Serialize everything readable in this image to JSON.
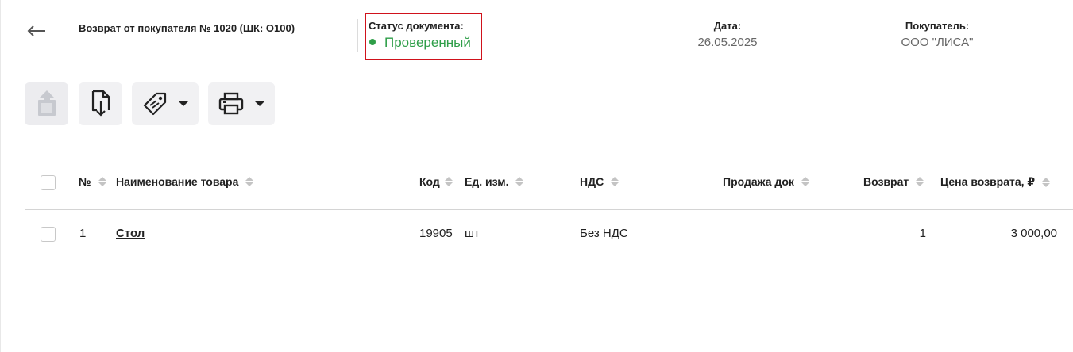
{
  "header": {
    "title": "Возврат от покупателя № 1020 (ШК: O100)",
    "status_label": "Статус документа:",
    "status_value": "Проверенный",
    "date_label": "Дата:",
    "date_value": "26.05.2025",
    "buyer_label": "Покупатель:",
    "buyer_value": "ООО \"ЛИСА\""
  },
  "toolbar": {
    "buttons": [
      {
        "icon": "export-icon",
        "enabled": false
      },
      {
        "icon": "file-download-icon",
        "enabled": true
      },
      {
        "icon": "price-tag-icon",
        "enabled": true,
        "dropdown": true
      },
      {
        "icon": "printer-icon",
        "enabled": true,
        "dropdown": true
      }
    ]
  },
  "table": {
    "columns": [
      "№",
      "Наименование товара",
      "Код",
      "Ед. изм.",
      "НДС",
      "Продажа док",
      "Возврат",
      "Цена возврата, ₽"
    ],
    "rows": [
      {
        "num": "1",
        "name": "Стол",
        "code": "19905",
        "unit": "шт",
        "vat": "Без НДС",
        "sale_doc": "",
        "return_qty": "1",
        "return_price": "3 000,00"
      }
    ]
  },
  "colors": {
    "status_green": "#2e9e48",
    "highlight_red": "#d0121b",
    "button_bg": "#f1f1f3"
  }
}
